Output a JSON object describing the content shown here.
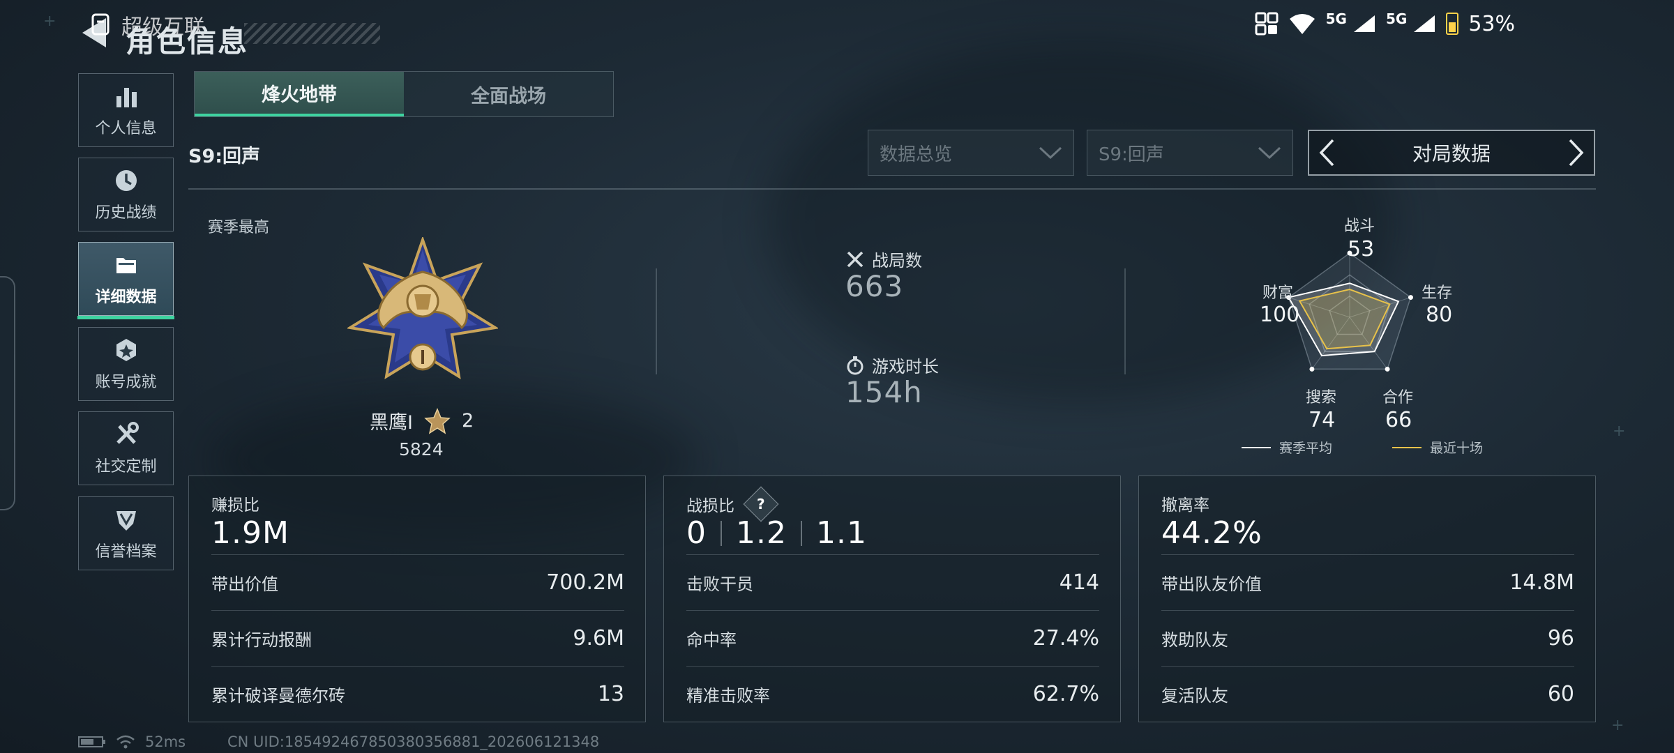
{
  "status_bar": {
    "net1": "5G",
    "net2": "5G",
    "battery": "53%"
  },
  "header": {
    "overlay_title": "超级互联",
    "title": "角色信息"
  },
  "sidebar": {
    "items": [
      {
        "label": "个人信息",
        "icon": "bar-chart-icon"
      },
      {
        "label": "历史战绩",
        "icon": "clock-icon"
      },
      {
        "label": "详细数据",
        "icon": "folder-icon",
        "active": true
      },
      {
        "label": "账号成就",
        "icon": "achievement-icon"
      },
      {
        "label": "社交定制",
        "icon": "tools-icon"
      },
      {
        "label": "信誉档案",
        "icon": "shield-icon"
      }
    ]
  },
  "mode_tabs": [
    {
      "label": "烽火地带",
      "active": true
    },
    {
      "label": "全面战场"
    }
  ],
  "season": "S9:回声",
  "filters": {
    "overview": "数据总览",
    "season": "S9:回声",
    "match_data": "对局数据"
  },
  "season_best": {
    "label": "赛季最高",
    "rank": "黑鹰I",
    "stars": "2",
    "score": "5824"
  },
  "summary": {
    "matches_label": "战局数",
    "matches_value": "663",
    "playtime_label": "游戏时长",
    "playtime_value": "154h"
  },
  "radar": {
    "axes": [
      {
        "label": "战斗",
        "value": "53"
      },
      {
        "label": "生存",
        "value": "80"
      },
      {
        "label": "合作",
        "value": "66"
      },
      {
        "label": "搜索",
        "value": "74"
      },
      {
        "label": "财富",
        "value": "100"
      }
    ],
    "recent_fraction": [
      0.53,
      0.8,
      0.66,
      0.74,
      1.0
    ],
    "legend_avg": "赛季平均",
    "legend_recent": "最近十场",
    "avg_color": "#ffffff",
    "recent_color": "#e8c24a"
  },
  "cards": {
    "profit": {
      "label": "赚损比",
      "value": "1.9M",
      "rows": [
        {
          "label": "带出价值",
          "value": "700.2M"
        },
        {
          "label": "累计行动报酬",
          "value": "9.6M"
        },
        {
          "label": "累计破译曼德尔砖",
          "value": "13"
        }
      ]
    },
    "kd": {
      "label": "战损比",
      "help": "?",
      "values": [
        "0",
        "1.2",
        "1.1"
      ],
      "rows": [
        {
          "label": "击败干员",
          "value": "414"
        },
        {
          "label": "命中率",
          "value": "27.4%"
        },
        {
          "label": "精准击败率",
          "value": "62.7%"
        }
      ]
    },
    "extract": {
      "label": "撤离率",
      "value": "44.2%",
      "rows": [
        {
          "label": "带出队友价值",
          "value": "14.8M"
        },
        {
          "label": "救助队友",
          "value": "96"
        },
        {
          "label": "复活队友",
          "value": "60"
        }
      ]
    }
  },
  "footer": {
    "ping": "52ms",
    "uid": "CN UID:185492467850380356881_202606121348"
  },
  "accent_color": "#3ed3a0"
}
